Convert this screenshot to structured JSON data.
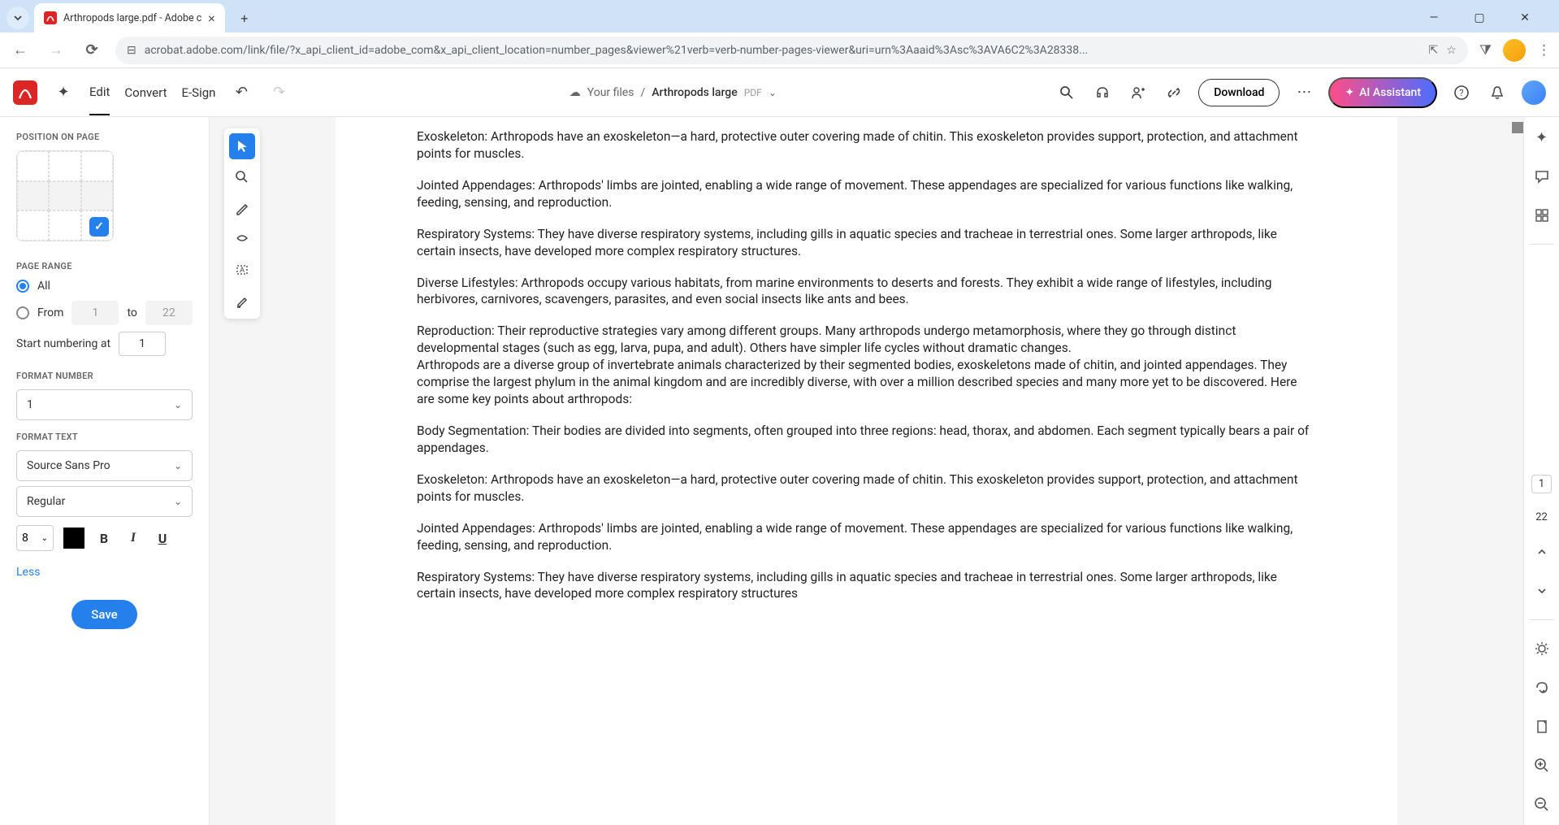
{
  "browser": {
    "tab_title": "Arthropods large.pdf - Adobe c",
    "url": "acrobat.adobe.com/link/file/?x_api_client_id=adobe_com&x_api_client_location=number_pages&viewer%21verb=verb-number-pages-viewer&uri=urn%3Aaaid%3Asc%3AVA6C2%3A28338..."
  },
  "toolbar": {
    "edit": "Edit",
    "convert": "Convert",
    "esign": "E-Sign",
    "breadcrumb_root": "Your files",
    "breadcrumb_file": "Arthropods large",
    "breadcrumb_ext": "PDF",
    "download": "Download",
    "ai": "AI Assistant"
  },
  "panel": {
    "position_label": "POSITION ON PAGE",
    "range_label": "PAGE RANGE",
    "radio_all": "All",
    "radio_from": "From",
    "range_from": "1",
    "range_to_label": "to",
    "range_to": "22",
    "start_label": "Start numbering at",
    "start_value": "1",
    "format_number_label": "FORMAT NUMBER",
    "format_number_value": "1",
    "format_text_label": "FORMAT TEXT",
    "font_family": "Source Sans Pro",
    "font_weight": "Regular",
    "font_size": "8",
    "less": "Less",
    "save": "Save"
  },
  "doc": {
    "p1": "Exoskeleton: Arthropods have an exoskeleton—a hard, protective outer covering made of chitin. This exoskeleton provides support, protection, and attachment points for muscles.",
    "p2": "Jointed Appendages: Arthropods' limbs are jointed, enabling a wide range of movement. These appendages are specialized for various functions like walking, feeding, sensing, and reproduction.",
    "p3": "Respiratory Systems: They have diverse respiratory systems, including gills in aquatic species and tracheae in terrestrial ones. Some larger arthropods, like certain insects, have developed more complex respiratory structures.",
    "p4": "Diverse Lifestyles: Arthropods occupy various habitats, from marine environments to deserts and forests. They exhibit a wide range of lifestyles, including herbivores, carnivores, scavengers, parasites, and even social insects like ants and bees.",
    "p5": "Reproduction: Their reproductive strategies vary among different groups. Many arthropods undergo metamorphosis, where they go through distinct developmental stages (such as egg, larva, pupa, and adult). Others have simpler life cycles without dramatic changes.",
    "p6": "Arthropods are a diverse group of invertebrate animals characterized by their segmented bodies, exoskeletons made of chitin, and jointed appendages. They comprise the largest phylum in the animal kingdom and are incredibly diverse, with over a million described species and many more yet to be discovered. Here are some key points about arthropods:",
    "p7": "Body Segmentation: Their bodies are divided into segments, often grouped into three regions: head, thorax, and abdomen. Each segment typically bears a pair of appendages.",
    "p8": "Exoskeleton: Arthropods have an exoskeleton—a hard, protective outer covering made of chitin. This exoskeleton provides support, protection, and attachment points for muscles.",
    "p9": "Jointed Appendages: Arthropods' limbs are jointed, enabling a wide range of movement. These appendages are specialized for various functions like walking, feeding, sensing, and reproduction.",
    "p10": "Respiratory Systems: They have diverse respiratory systems, including gills in aquatic species and tracheae in terrestrial ones. Some larger arthropods, like certain insects, have developed more complex respiratory structures"
  },
  "pager": {
    "current": "1",
    "total": "22"
  }
}
